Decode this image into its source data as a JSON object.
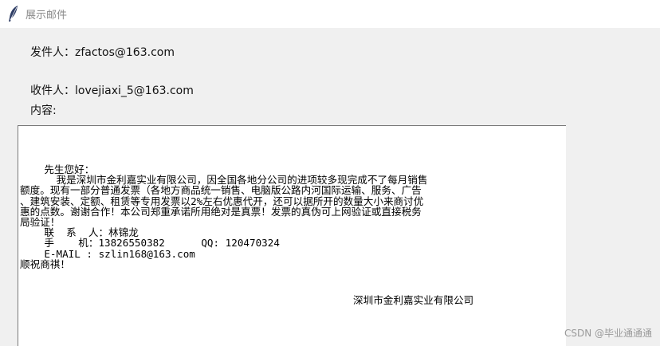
{
  "window": {
    "title": "展示邮件",
    "icon": "feather-icon"
  },
  "mail": {
    "from_label": "发件人：",
    "from_value": "zfactos@163.com",
    "to_label": "收件人：",
    "to_value": "lovejiaxi_5@163.com",
    "content_label": "内容:",
    "content_lines": [
      "    先生您好：",
      "      我是深圳市金利嘉实业有限公司，因全国各地分公司的进项较多现完成不了每月销售",
      "额度。现有一部分普通发票（各地方商品统一销售、电脑版公路内河国际运输、服务、广告",
      "、建筑安装、定额、租赁等专用发票以2%左右优惠代开，还可以据所开的数量大小来商讨优",
      "惠的点数。谢谢合作！本公司郑重承诺所用绝对是真票！发票的真伪可上网验证或直接税务",
      "局验证！",
      "    联  系  人：林锦龙",
      "    手    机：13826550382      QQ: 120470324",
      "    E-MAIL : szlin168@163.com",
      "顺祝商祺！"
    ],
    "signature": "深圳市金利嘉实业有限公司"
  },
  "watermark": "CSDN @毕业通通通"
}
